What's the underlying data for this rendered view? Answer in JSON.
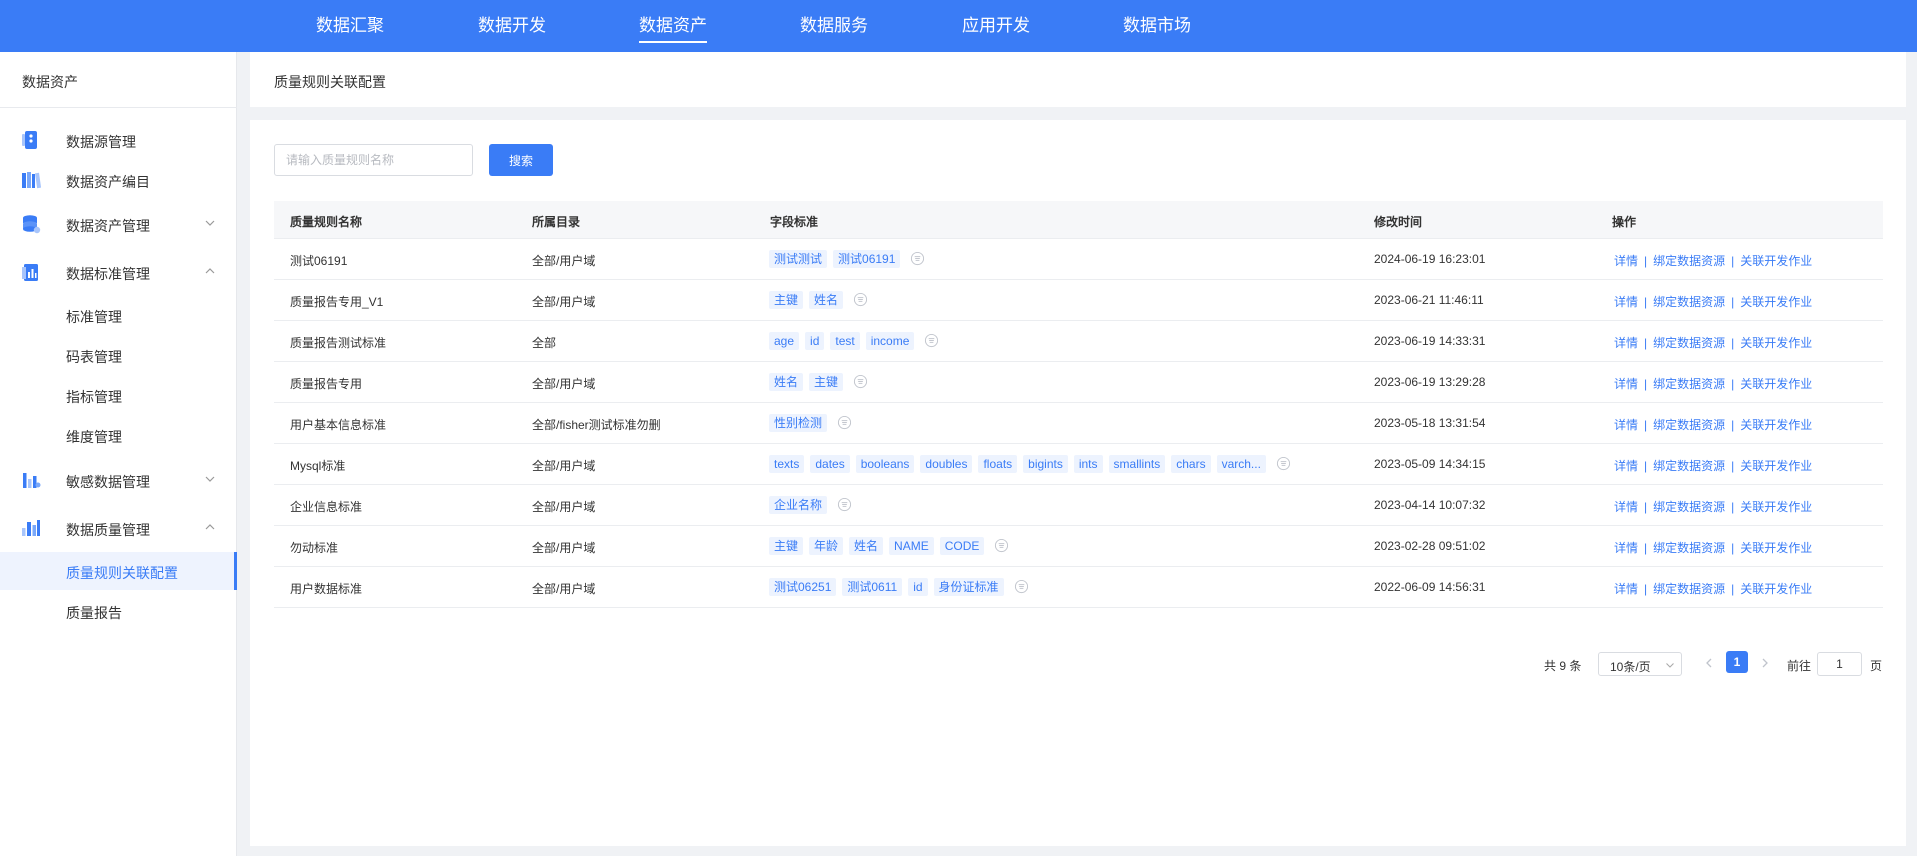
{
  "colors": {
    "primary": "#3a7cf6",
    "tag_bg": "#edf3fe",
    "page_bg": "#f0f2f5"
  },
  "topnav": [
    {
      "label": "数据汇聚",
      "active": false
    },
    {
      "label": "数据开发",
      "active": false
    },
    {
      "label": "数据资产",
      "active": true
    },
    {
      "label": "数据服务",
      "active": false
    },
    {
      "label": "应用开发",
      "active": false
    },
    {
      "label": "数据市场",
      "active": false
    }
  ],
  "sidebar": {
    "title": "数据资产",
    "items": [
      {
        "label": "数据源管理",
        "icon": "database-source-icon"
      },
      {
        "label": "数据资产编目",
        "icon": "catalog-books-icon"
      },
      {
        "label": "数据资产管理",
        "icon": "database-stack-icon",
        "expandable": true,
        "expanded": false
      },
      {
        "label": "数据标准管理",
        "icon": "standard-chart-icon",
        "expandable": true,
        "expanded": true,
        "children": [
          "标准管理",
          "码表管理",
          "指标管理",
          "维度管理"
        ]
      },
      {
        "label": "敏感数据管理",
        "icon": "sensitive-bars-icon",
        "expandable": true,
        "expanded": false
      },
      {
        "label": "数据质量管理",
        "icon": "quality-bars-icon",
        "expandable": true,
        "expanded": true,
        "children": [
          "质量规则关联配置",
          "质量报告"
        ],
        "active_child": "质量规则关联配置"
      }
    ]
  },
  "page": {
    "title": "质量规则关联配置"
  },
  "search": {
    "placeholder": "请输入质量规则名称",
    "button_label": "搜索",
    "value": ""
  },
  "table": {
    "headers": {
      "name": "质量规则名称",
      "catalog": "所属目录",
      "fields": "字段标准",
      "modified": "修改时间",
      "actions": "操作"
    },
    "action_labels": {
      "detail": "详情",
      "bind": "绑定数据资源",
      "link": "关联开发作业",
      "separator": "|"
    },
    "rows": [
      {
        "name": "测试06191",
        "catalog": "全部/用户域",
        "tags": [
          "测试测试",
          "测试06191"
        ],
        "modified": "2024-06-19 16:23:01"
      },
      {
        "name": "质量报告专用_V1",
        "catalog": "全部/用户域",
        "tags": [
          "主键",
          "姓名"
        ],
        "modified": "2023-06-21 11:46:11"
      },
      {
        "name": "质量报告测试标准",
        "catalog": "全部",
        "tags": [
          "age",
          "id",
          "test",
          "income"
        ],
        "modified": "2023-06-19 14:33:31"
      },
      {
        "name": "质量报告专用",
        "catalog": "全部/用户域",
        "tags": [
          "姓名",
          "主键"
        ],
        "modified": "2023-06-19 13:29:28"
      },
      {
        "name": "用户基本信息标准",
        "catalog": "全部/fisher测试标准勿删",
        "tags": [
          "性别检测"
        ],
        "modified": "2023-05-18 13:31:54"
      },
      {
        "name": "Mysql标准",
        "catalog": "全部/用户域",
        "tags": [
          "texts",
          "dates",
          "booleans",
          "doubles",
          "floats",
          "bigints",
          "ints",
          "smallints",
          "chars",
          "varch..."
        ],
        "modified": "2023-05-09 14:34:15"
      },
      {
        "name": "企业信息标准",
        "catalog": "全部/用户域",
        "tags": [
          "企业名称"
        ],
        "modified": "2023-04-14 10:07:32"
      },
      {
        "name": "勿动标准",
        "catalog": "全部/用户域",
        "tags": [
          "主键",
          "年龄",
          "姓名",
          "NAME",
          "CODE"
        ],
        "modified": "2023-02-28 09:51:02"
      },
      {
        "name": "用户数据标准",
        "catalog": "全部/用户域",
        "tags": [
          "测试06251",
          "测试0611",
          "id",
          "身份证标准"
        ],
        "modified": "2022-06-09 14:56:31"
      }
    ]
  },
  "pagination": {
    "total_label": "共 9 条",
    "page_size_label": "10条/页",
    "current_page": "1",
    "goto_label": "前往",
    "goto_value": "1",
    "page_suffix": "页"
  }
}
